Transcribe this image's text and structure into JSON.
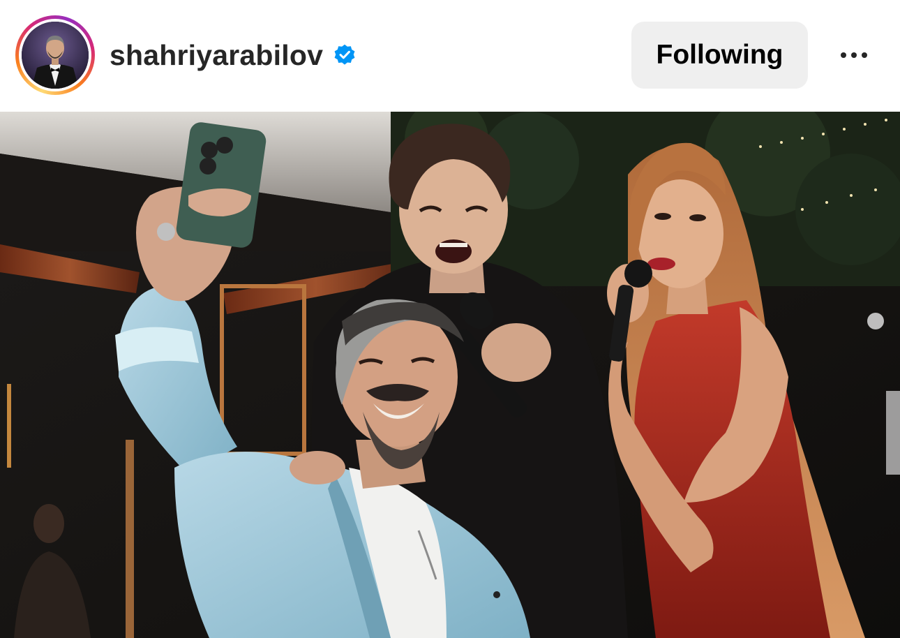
{
  "post_header": {
    "username": "shahriyarabilov",
    "verified": true,
    "verified_icon": "verified-badge-icon",
    "follow_label": "Following",
    "more_icon": "more-options-icon"
  },
  "post": {
    "image_icon": "photo",
    "content_description": "selfie at party with two singers holding microphones"
  },
  "colors": {
    "verified_blue": "#0095f6",
    "button_bg": "#efefef",
    "text_primary": "#262626"
  }
}
